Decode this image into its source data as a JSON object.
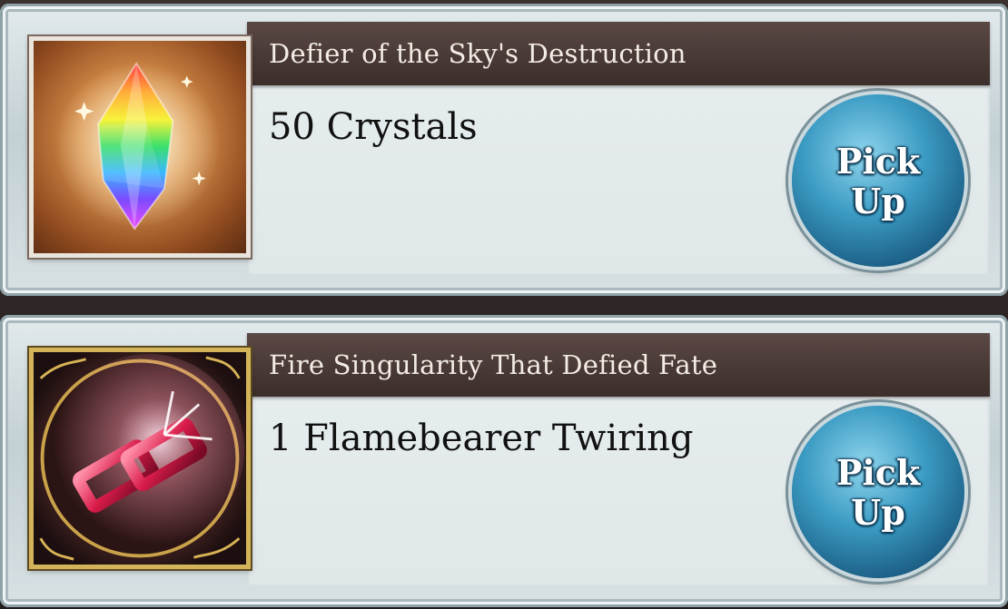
{
  "rewards": [
    {
      "title": "Defier of the Sky's Destruction",
      "reward": "50 Crystals",
      "icon": "rainbow-crystal-icon",
      "button_label": "Pick\nUp"
    },
    {
      "title": "Fire Singularity That Defied Fate",
      "reward": "1 Flamebearer Twiring",
      "icon": "flamebearer-twiring-icon",
      "button_label": "Pick\nUp"
    }
  ],
  "colors": {
    "title_bar": "#4a3a36",
    "button": "#3c9cc4",
    "panel": "#dfe7e9"
  }
}
